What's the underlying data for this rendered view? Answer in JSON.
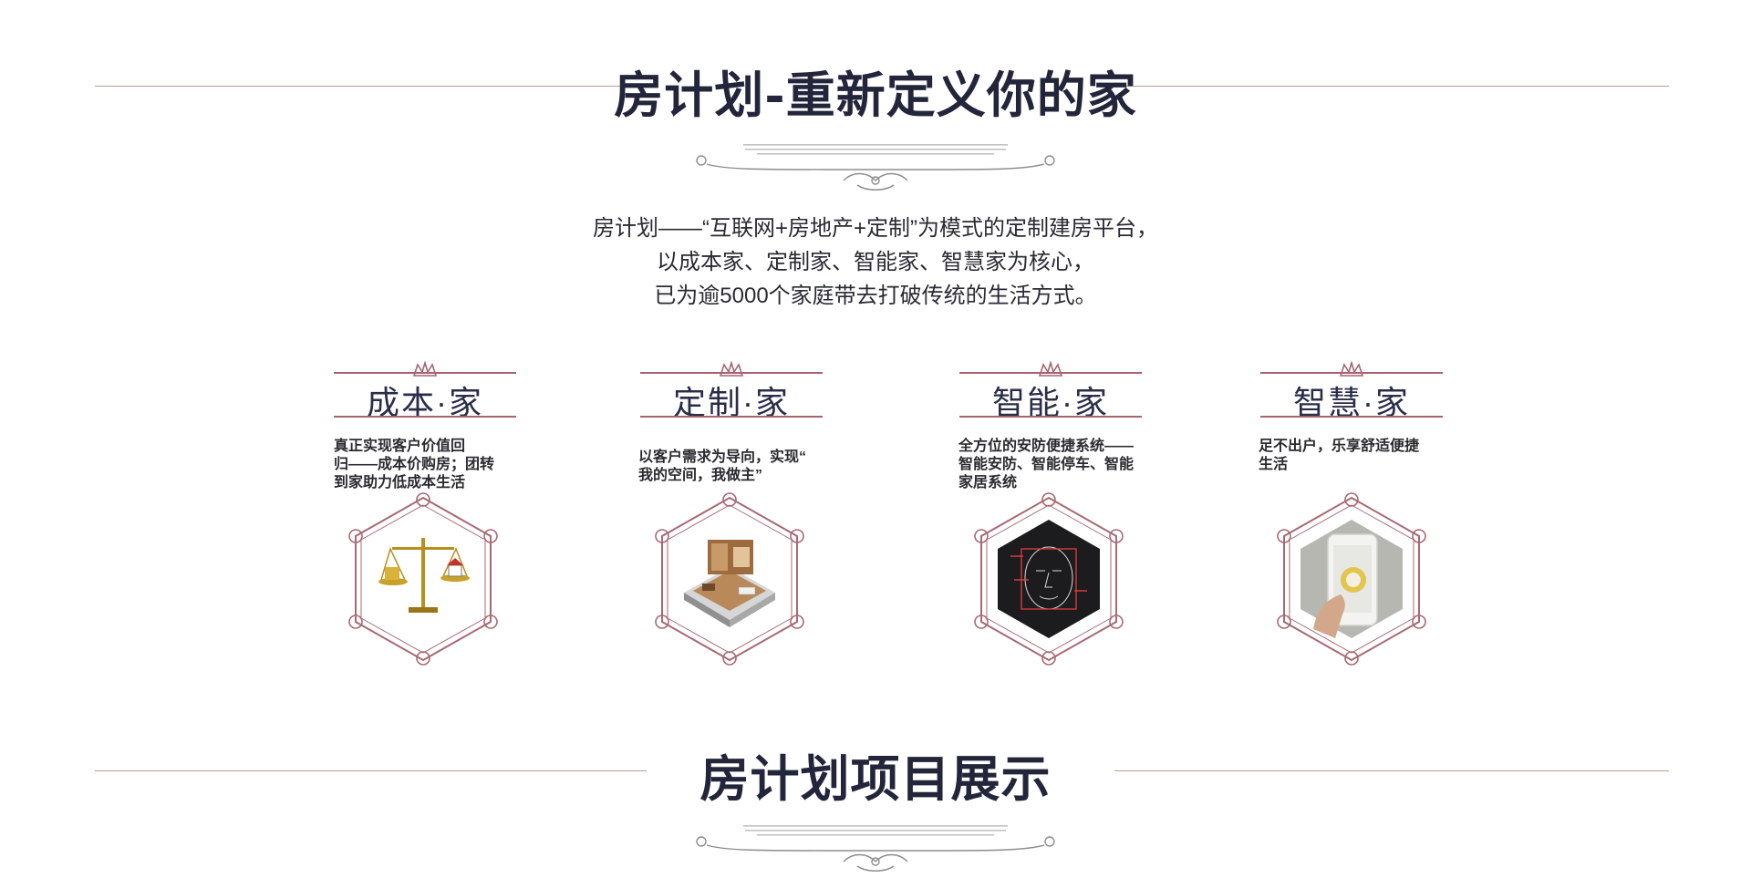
{
  "section1": {
    "title": "房计划-重新定义你的家"
  },
  "intro": {
    "lines": [
      "房计划——“互联网+房地产+定制”为模式的定制建房平台，",
      "以成本家、定制家、智能家、智慧家为核心，",
      "已为逾5000个家庭带去打破传统的生活方式。"
    ]
  },
  "features": [
    {
      "name": "成本·家",
      "desc": [
        "真正实现客户价值回",
        "归——成本价购房；团转",
        "到家助力低成本生活"
      ],
      "image": "scales-with-house-icon"
    },
    {
      "name": "定制·家",
      "desc": [
        "以客户需求为导向，实现“",
        "我的空间，我做主”"
      ],
      "image": "building-cutaway-icon"
    },
    {
      "name": "智能·家",
      "desc": [
        "全方位的安防便捷系统——",
        "智能安防、智能停车、智能",
        "家居系统"
      ],
      "image": "face-scan-icon"
    },
    {
      "name": "智慧·家",
      "desc": [
        "足不出户，乐享舒适便捷",
        "生活"
      ],
      "image": "smartphone-app-icon"
    }
  ],
  "section2": {
    "title": "房计划项目展示"
  },
  "colors": {
    "accent": "#a7646e",
    "title": "#23263b",
    "rule": "#b49f8f"
  }
}
